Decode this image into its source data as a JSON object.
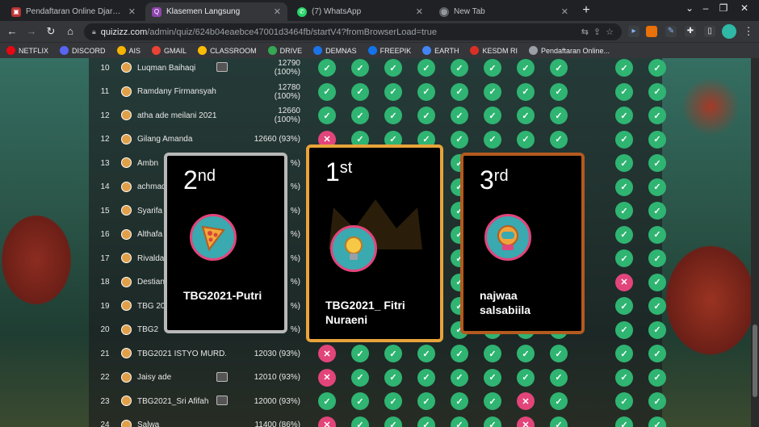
{
  "tabs": [
    {
      "title": "Pendaftaran Online Djarum Bea:",
      "active": false
    },
    {
      "title": "Klasemen Langsung",
      "active": true
    },
    {
      "title": "(7) WhatsApp",
      "active": false
    },
    {
      "title": "New Tab",
      "active": false
    }
  ],
  "address": {
    "host": "quizizz.com",
    "path": "/admin/quiz/624b04eaebce47001d3464fb/startV4?fromBrowserLoad=true"
  },
  "bookmarks": [
    {
      "label": "NETFLIX",
      "color": "#e50914"
    },
    {
      "label": "DISCORD",
      "color": "#5865f2"
    },
    {
      "label": "AIS",
      "color": "#f4b400"
    },
    {
      "label": "GMAIL",
      "color": "#ea4335"
    },
    {
      "label": "CLASSROOM",
      "color": "#fbbc04"
    },
    {
      "label": "DRIVE",
      "color": "#34a853"
    },
    {
      "label": "DEMNAS",
      "color": "#1a73e8"
    },
    {
      "label": "FREEPIK",
      "color": "#1273eb"
    },
    {
      "label": "EARTH",
      "color": "#4285f4"
    },
    {
      "label": "KESDM RI",
      "color": "#d93025"
    },
    {
      "label": "Pendaftaran Online...",
      "color": "#9aa0a6"
    }
  ],
  "rows": [
    {
      "rank": "10",
      "name": "Luqman Baihaqi",
      "score": "12790 (100%)",
      "mail": true,
      "marks": [
        "ok",
        "ok",
        "ok",
        "ok",
        "ok",
        "ok",
        "ok",
        "ok",
        "ok",
        "ok"
      ]
    },
    {
      "rank": "11",
      "name": "Ramdany Firmansyah",
      "score": "12780 (100%)",
      "mail": false,
      "marks": [
        "ok",
        "ok",
        "ok",
        "ok",
        "ok",
        "ok",
        "ok",
        "ok",
        "ok",
        "ok"
      ]
    },
    {
      "rank": "12",
      "name": "atha ade meilani 2021",
      "score": "12660 (100%)",
      "mail": false,
      "marks": [
        "ok",
        "ok",
        "ok",
        "ok",
        "ok",
        "ok",
        "ok",
        "ok",
        "ok",
        "ok"
      ]
    },
    {
      "rank": "12",
      "name": "Gilang Amanda",
      "score": "12660 (93%)",
      "mail": false,
      "marks": [
        "bad",
        "ok",
        "ok",
        "ok",
        "ok",
        "ok",
        "ok",
        "ok",
        "ok",
        "ok"
      ]
    },
    {
      "rank": "13",
      "name": "Ambn",
      "score": "%)",
      "mail": false,
      "marks": [
        "ok",
        "ok",
        "ok",
        "ok",
        "ok",
        "ok",
        "ok",
        "ok",
        "ok",
        "ok"
      ]
    },
    {
      "rank": "14",
      "name": "achmad",
      "score": "%)",
      "mail": false,
      "marks": [
        "ok",
        "ok",
        "ok",
        "ok",
        "ok",
        "ok",
        "ok",
        "ok",
        "ok",
        "ok"
      ]
    },
    {
      "rank": "15",
      "name": "Syarifa",
      "score": "%)",
      "mail": false,
      "marks": [
        "ok",
        "ok",
        "ok",
        "ok",
        "ok",
        "ok",
        "ok",
        "ok",
        "ok",
        "ok"
      ]
    },
    {
      "rank": "16",
      "name": "Althafa",
      "score": "%)",
      "mail": false,
      "marks": [
        "ok",
        "ok",
        "ok",
        "ok",
        "ok",
        "ok",
        "ok",
        "ok",
        "ok",
        "ok"
      ]
    },
    {
      "rank": "17",
      "name": "Rivalda",
      "score": "%)",
      "mail": false,
      "marks": [
        "ok",
        "ok",
        "ok",
        "ok",
        "ok",
        "ok",
        "ok",
        "ok",
        "ok",
        "ok"
      ]
    },
    {
      "rank": "18",
      "name": "Destian",
      "score": "%)",
      "mail": false,
      "marks": [
        "ok",
        "ok",
        "ok",
        "ok",
        "ok",
        "ok",
        "ok",
        "ok",
        "bad",
        "ok"
      ]
    },
    {
      "rank": "19",
      "name": "TBG 20",
      "score": "%)",
      "mail": false,
      "marks": [
        "ok",
        "ok",
        "ok",
        "ok",
        "ok",
        "ok",
        "ok",
        "ok",
        "ok",
        "ok"
      ]
    },
    {
      "rank": "20",
      "name": "TBG2",
      "score": "%)",
      "mail": false,
      "marks": [
        "ok",
        "ok",
        "ok",
        "ok",
        "ok",
        "ok",
        "ok",
        "ok",
        "ok",
        "ok"
      ]
    },
    {
      "rank": "21",
      "name": "TBG2021 ISTYO MURD...",
      "score": "12030 (93%)",
      "mail": false,
      "marks": [
        "bad",
        "ok",
        "ok",
        "ok",
        "ok",
        "ok",
        "ok",
        "ok",
        "ok",
        "ok"
      ]
    },
    {
      "rank": "22",
      "name": "Jaisy ade",
      "score": "12010 (93%)",
      "mail": true,
      "marks": [
        "bad",
        "ok",
        "ok",
        "ok",
        "ok",
        "ok",
        "ok",
        "ok",
        "ok",
        "ok"
      ]
    },
    {
      "rank": "23",
      "name": "TBG2021_Sri Afifah",
      "score": "12000 (93%)",
      "mail": true,
      "marks": [
        "ok",
        "ok",
        "ok",
        "ok",
        "ok",
        "ok",
        "bad",
        "ok",
        "ok",
        "ok"
      ]
    },
    {
      "rank": "24",
      "name": "Salwa",
      "score": "11400 (86%)",
      "mail": false,
      "marks": [
        "bad",
        "ok",
        "ok",
        "ok",
        "ok",
        "ok",
        "bad",
        "ok",
        "ok",
        "ok"
      ]
    }
  ],
  "podium": [
    {
      "place": "2",
      "suffix": "nd",
      "name": "TBG2021-Putri",
      "border": "#b9b9b9"
    },
    {
      "place": "1",
      "suffix": "st",
      "name": "TBG2021_ Fitri Nuraeni",
      "border": "#e8a43a"
    },
    {
      "place": "3",
      "suffix": "rd",
      "name": "najwaa salsabiila",
      "border": "#b35a1f"
    }
  ],
  "icons": {
    "check": "✓",
    "cross": "✕"
  }
}
